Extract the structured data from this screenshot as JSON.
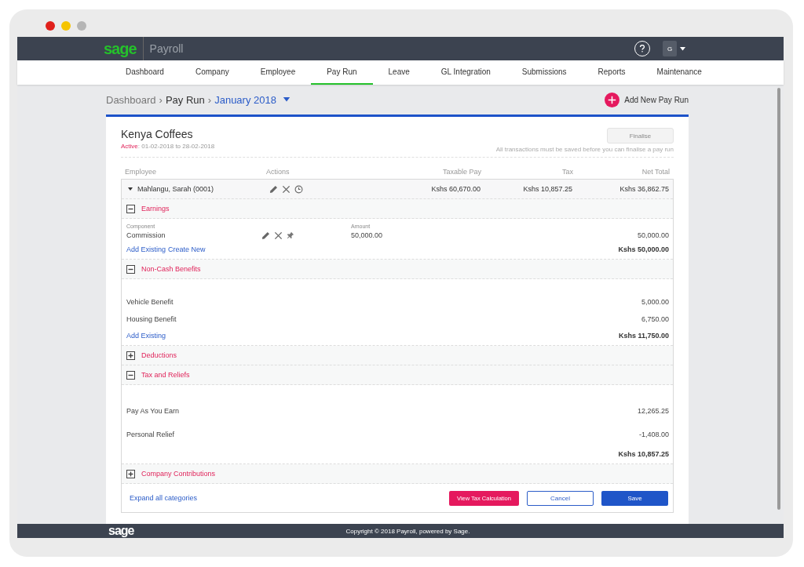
{
  "brand": {
    "logo": "sage",
    "product": "Payroll"
  },
  "user": {
    "initial": "G"
  },
  "nav": [
    {
      "label": "Dashboard",
      "selected": false
    },
    {
      "label": "Company",
      "selected": false
    },
    {
      "label": "Employee",
      "selected": false
    },
    {
      "label": "Pay Run",
      "selected": true
    },
    {
      "label": "Leave",
      "selected": false
    },
    {
      "label": "GL Integration",
      "selected": false
    },
    {
      "label": "Submissions",
      "selected": false
    },
    {
      "label": "Reports",
      "selected": false
    },
    {
      "label": "Maintenance",
      "selected": false
    }
  ],
  "breadcrumb": {
    "items": [
      "Dashboard",
      "Pay Run"
    ],
    "separator": "›",
    "current": "January 2018"
  },
  "add_button": "Add New Pay Run",
  "company": {
    "name": "Kenya Coffees",
    "status": "Active",
    "period": ": 01-02-2018 to 28-02-2018"
  },
  "finalise": {
    "label": "Finalise",
    "disabled": true,
    "note": "All transactions must be saved before you can finalise a pay run"
  },
  "columns": [
    "Employee",
    "Actions",
    "Taxable Pay",
    "Tax",
    "Net Total"
  ],
  "employee": {
    "name": "Mahlangu, Sarah (0001)",
    "expanded": true,
    "taxable_pay": "Kshs 60,670.00",
    "tax": "Kshs 10,857.25",
    "net_total": "Kshs 36,862.75"
  },
  "sections": [
    {
      "title": "Earnings",
      "expanded": true,
      "labels": [
        "Component",
        "Amount"
      ],
      "rows": [
        {
          "kind": "component",
          "label": "Commission",
          "amount": "50,000.00",
          "value": "50,000.00"
        }
      ],
      "links": [
        "Add Existing",
        "Create New"
      ],
      "total": "Kshs 50,000.00"
    },
    {
      "title": "Non-Cash Benefits",
      "expanded": true,
      "rows": [
        {
          "kind": "plain",
          "label": "Vehicle Benefit",
          "value": "5,000.00"
        },
        {
          "kind": "plain",
          "label": "Housing Benefit",
          "value": "6,750.00"
        }
      ],
      "links": [
        "Add Existing"
      ],
      "total": "Kshs 11,750.00"
    },
    {
      "title": "Deductions",
      "expanded": false
    },
    {
      "title": "Tax and Reliefs",
      "expanded": true,
      "rows": [
        {
          "kind": "tall",
          "label": "Pay As You Earn",
          "value": "12,265.25"
        },
        {
          "kind": "tall",
          "label": "Personal Relief",
          "value": "-1,408.00"
        }
      ],
      "total": "Kshs 10,857.25"
    },
    {
      "title": "Company Contributions",
      "expanded": false
    }
  ],
  "expand_all": "Expand all categories",
  "buttons": {
    "view_tax": "View Tax Calculation",
    "cancel": "Cancel",
    "save": "Save"
  },
  "footer": {
    "logo": "sage",
    "copyright": "Copyright © 2018 Payroll, powered by Sage."
  }
}
